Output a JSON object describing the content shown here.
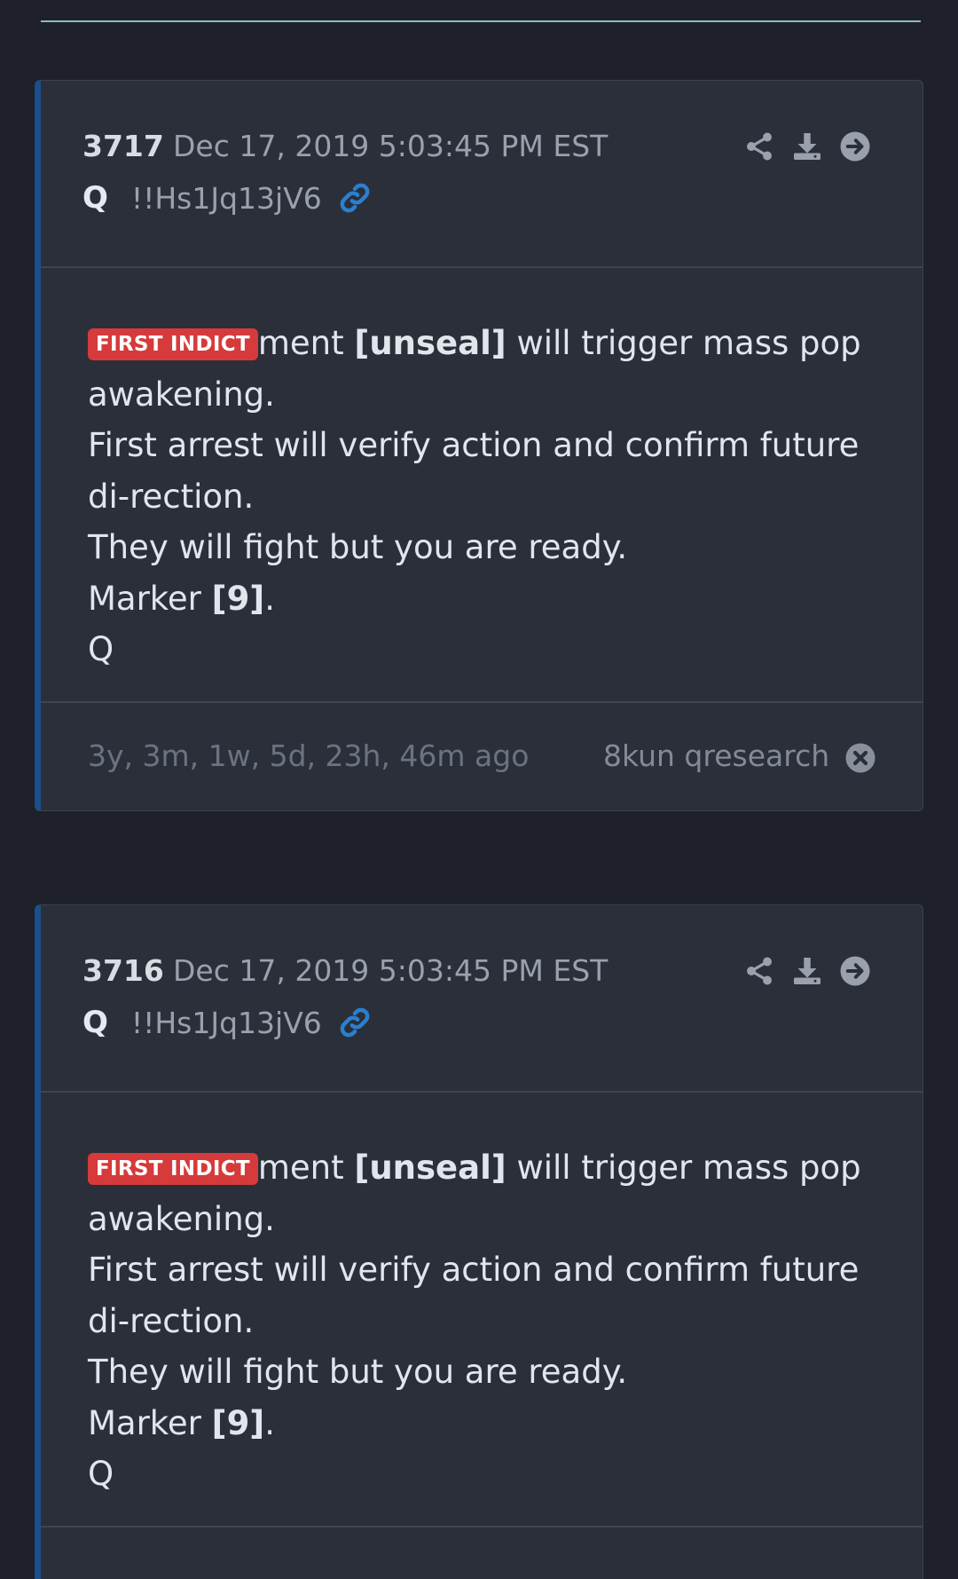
{
  "posts": [
    {
      "number": "3717",
      "date": "Dec 17, 2019 5:03:45 PM EST",
      "author": "Q",
      "tripcode": "!!Hs1Jq13jV6",
      "tag": "FIRST INDICT",
      "line1_suffix": "ment ",
      "line1_bold": "[unseal]",
      "line1_rest": " will trigger mass pop awakening.",
      "line2": "First arrest will verify action and confirm future di-rection.",
      "line3": "They will fight but you are ready.",
      "line4_prefix": "Marker ",
      "line4_bold": "[9]",
      "line4_suffix": ".",
      "signature": "Q",
      "ago": "3y, 3m, 1w, 5d, 23h, 46m ago",
      "source": "8kun qresearch"
    },
    {
      "number": "3716",
      "date": "Dec 17, 2019 5:03:45 PM EST",
      "author": "Q",
      "tripcode": "!!Hs1Jq13jV6",
      "tag": "FIRST INDICT",
      "line1_suffix": "ment ",
      "line1_bold": "[unseal]",
      "line1_rest": " will trigger mass pop awakening.",
      "line2": "First arrest will verify action and confirm future di-rection.",
      "line3": "They will fight but you are ready.",
      "line4_prefix": "Marker ",
      "line4_bold": "[9]",
      "line4_suffix": ".",
      "signature": "Q"
    }
  ],
  "icons": {
    "share": "share-icon",
    "download": "download-icon",
    "goto": "arrow-right-circle-icon",
    "link": "link-icon",
    "close": "close-icon"
  },
  "colors": {
    "background": "#1e2129",
    "card": "#2b2f39",
    "accent_border": "#1a4f8a",
    "link": "#2b7fd0",
    "tag": "#d63a3a"
  }
}
